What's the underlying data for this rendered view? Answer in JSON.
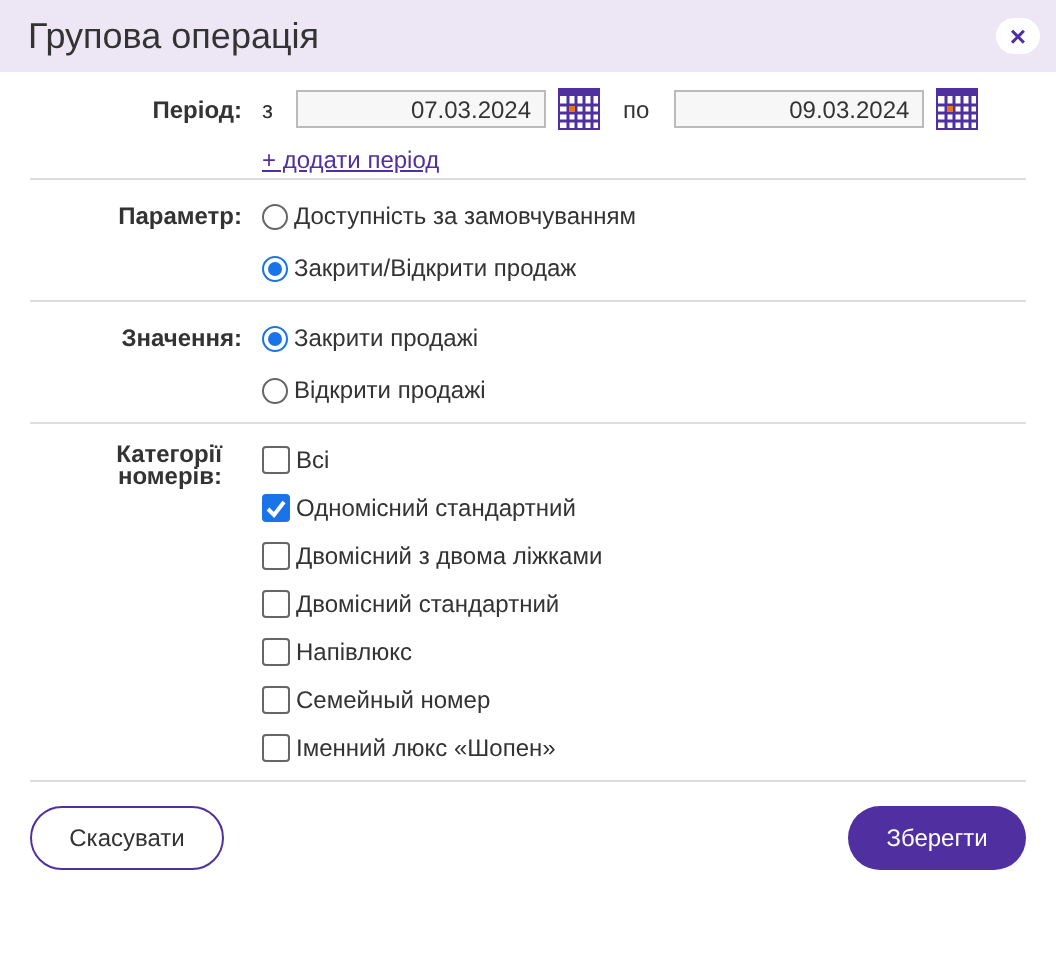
{
  "window": {
    "title": "Групова операція",
    "close": "×"
  },
  "period": {
    "label": "Період:",
    "from_label": "з",
    "from": "07.03.2024",
    "to_label": "по",
    "to": "09.03.2024",
    "add_link": "+ додати період"
  },
  "parameter": {
    "label": "Параметр:",
    "options": [
      {
        "label": "Доступність за замовчуванням",
        "selected": false
      },
      {
        "label": "Закрити/Відкрити продаж",
        "selected": true
      }
    ]
  },
  "value": {
    "label": "Значення:",
    "options": [
      {
        "label": "Закрити продажі",
        "selected": true
      },
      {
        "label": "Відкрити продажі",
        "selected": false
      }
    ]
  },
  "categories": {
    "label": "Категорії номерів:",
    "items": [
      {
        "label": "Всі",
        "checked": false
      },
      {
        "label": "Одномісний стандартний",
        "checked": true
      },
      {
        "label": "Двомісний з двома ліжками",
        "checked": false
      },
      {
        "label": "Двомісний стандартний",
        "checked": false
      },
      {
        "label": "Напівлюкс",
        "checked": false
      },
      {
        "label": "Семейный номер",
        "checked": false
      },
      {
        "label": "Іменний люкс «Шопен»",
        "checked": false
      }
    ]
  },
  "buttons": {
    "cancel": "Скасувати",
    "save": "Зберегти"
  }
}
